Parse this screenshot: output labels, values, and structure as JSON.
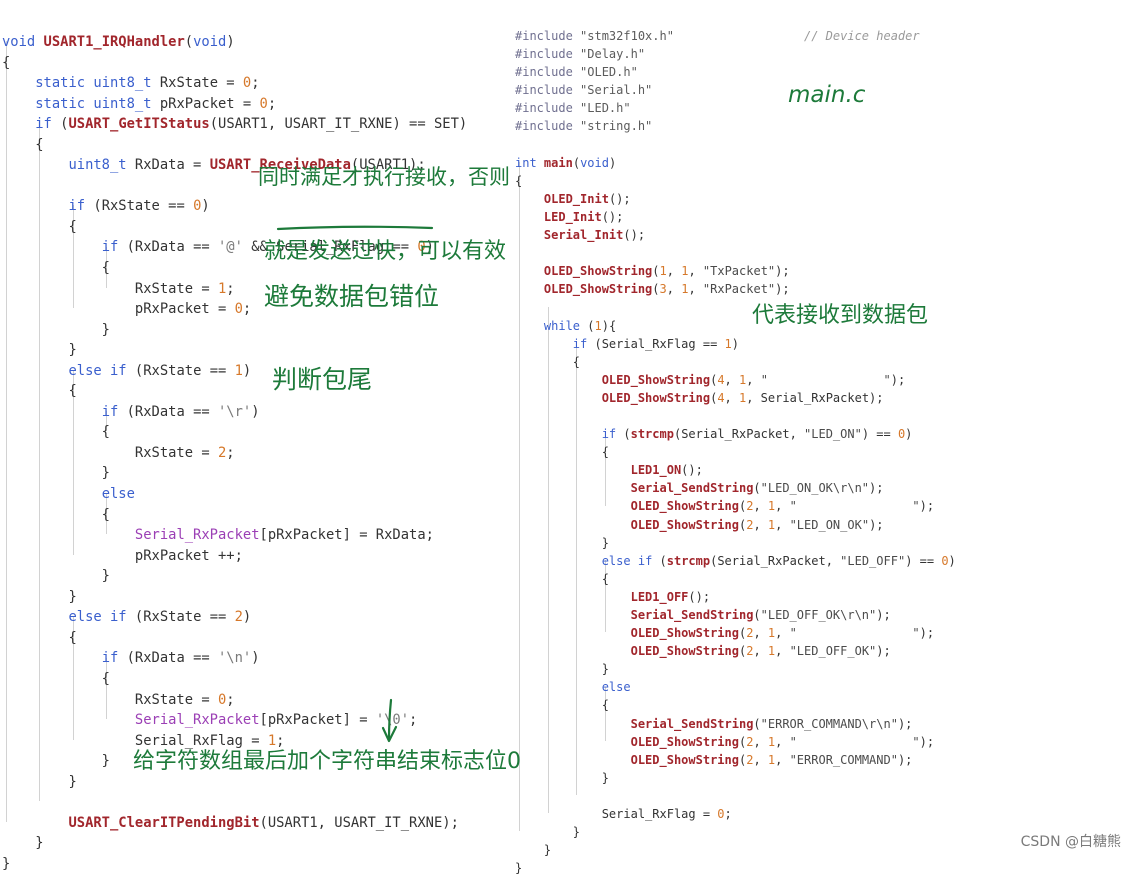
{
  "left_pane": {
    "lines": [
      "void USART1_IRQHandler(void)",
      "{",
      "    static uint8_t RxState = 0;",
      "    static uint8_t pRxPacket = 0;",
      "    if (USART_GetITStatus(USART1, USART_IT_RXNE) == SET)",
      "    {",
      "        uint8_t RxData = USART_ReceiveData(USART1);",
      "",
      "        if (RxState == 0)",
      "        {",
      "            if (RxData == '@' && Serial_RxFlag == 0)",
      "            {",
      "                RxState = 1;",
      "                pRxPacket = 0;",
      "            }",
      "        }",
      "        else if (RxState == 1)",
      "        {",
      "            if (RxData == '\\r')",
      "            {",
      "                RxState = 2;",
      "            }",
      "            else",
      "            {",
      "                Serial_RxPacket[pRxPacket] = RxData;",
      "                pRxPacket ++;",
      "            }",
      "        }",
      "        else if (RxState == 2)",
      "        {",
      "            if (RxData == '\\n')",
      "            {",
      "                RxState = 0;",
      "                Serial_RxPacket[pRxPacket] = '\\0';",
      "                Serial_RxFlag = 1;",
      "            }",
      "        }",
      "",
      "        USART_ClearITPendingBit(USART1, USART_IT_RXNE);",
      "    }",
      "}"
    ]
  },
  "right_pane": {
    "lines": [
      "#include \"stm32f10x.h\"                  // Device header",
      "#include \"Delay.h\"",
      "#include \"OLED.h\"",
      "#include \"Serial.h\"",
      "#include \"LED.h\"",
      "#include \"string.h\"",
      "",
      "int main(void)",
      "{",
      "    OLED_Init();",
      "    LED_Init();",
      "    Serial_Init();",
      "",
      "    OLED_ShowString(1, 1, \"TxPacket\");",
      "    OLED_ShowString(3, 1, \"RxPacket\");",
      "",
      "    while (1){",
      "        if (Serial_RxFlag == 1)",
      "        {",
      "            OLED_ShowString(4, 1, \"                \");",
      "            OLED_ShowString(4, 1, Serial_RxPacket);",
      "",
      "            if (strcmp(Serial_RxPacket, \"LED_ON\") == 0)",
      "            {",
      "                LED1_ON();",
      "                Serial_SendString(\"LED_ON_OK\\r\\n\");",
      "                OLED_ShowString(2, 1, \"                \");",
      "                OLED_ShowString(2, 1, \"LED_ON_OK\");",
      "            }",
      "            else if (strcmp(Serial_RxPacket, \"LED_OFF\") == 0)",
      "            {",
      "                LED1_OFF();",
      "                Serial_SendString(\"LED_OFF_OK\\r\\n\");",
      "                OLED_ShowString(2, 1, \"                \");",
      "                OLED_ShowString(2, 1, \"LED_OFF_OK\");",
      "            }",
      "            else",
      "            {",
      "                Serial_SendString(\"ERROR_COMMAND\\r\\n\");",
      "                OLED_ShowString(2, 1, \"                \");",
      "                OLED_ShowString(2, 1, \"ERROR_COMMAND\");",
      "            }",
      "",
      "            Serial_RxFlag = 0;",
      "        }",
      "    }",
      "}"
    ]
  },
  "annotations": {
    "receive_condition": "同时满足才执行接收，否则",
    "too_fast": "就是发送过快，可以有效",
    "avoid_misalignment": "避免数据包错位",
    "packet_tail": "判断包尾",
    "file_label": "main.c",
    "packet_received": "代表接收到数据包",
    "terminator": "给字符数组最后加个字符串结束标志位0",
    "arrow_icon": "down-arrow-icon"
  },
  "watermark": "CSDN @白糖熊",
  "colors": {
    "background": "#ffffff",
    "code_text": "#333333",
    "keyword": "#3a5fcd",
    "function": "#a1262c",
    "global_variable": "#9b3fb5",
    "number": "#d6782a",
    "char_literal": "#7a7a7a",
    "string": "#4b4b4b",
    "preprocessor": "#707090",
    "header_name": "#5c5c5c",
    "comment": "#9a9a9a",
    "indent_guide": "#d2d2d2",
    "annotation": "#1d7a3a",
    "watermark": "#7a7a7a"
  }
}
